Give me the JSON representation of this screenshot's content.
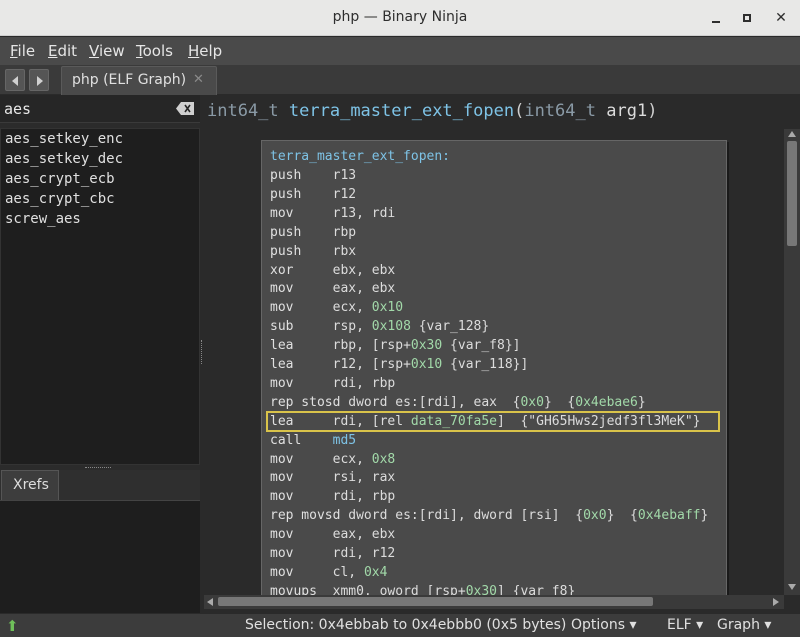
{
  "window": {
    "title": "php — Binary Ninja"
  },
  "menu": [
    "File",
    "Edit",
    "View",
    "Tools",
    "Help"
  ],
  "tab": {
    "label": "php (ELF Graph)"
  },
  "search": {
    "value": "aes"
  },
  "functions": [
    "aes_setkey_enc",
    "aes_setkey_dec",
    "aes_crypt_ecb",
    "aes_crypt_cbc",
    "screw_aes"
  ],
  "xrefs": {
    "tab_label": "Xrefs"
  },
  "signature": {
    "ret_type": "int64_t",
    "name": "terra_master_ext_fopen",
    "open": "(",
    "arg_type": "int64_t",
    "arg_name": "arg1",
    "close": ")"
  },
  "block": {
    "label": "terra_master_ext_fopen:",
    "instructions": [
      [
        "push",
        "r13"
      ],
      [
        "push",
        "r12"
      ],
      [
        "mov",
        "r13, rdi"
      ],
      [
        "push",
        "rbp"
      ],
      [
        "push",
        "rbx"
      ],
      [
        "xor",
        "ebx, ebx"
      ],
      [
        "mov",
        "eax, ebx"
      ],
      [
        "mov",
        "ecx, ",
        "0x10"
      ],
      [
        "sub",
        "rsp, ",
        "0x108",
        " {var_128}"
      ],
      [
        "lea",
        "rbp, [rsp+",
        "0x30",
        " {var_f8}]"
      ],
      [
        "lea",
        "r12, [rsp+",
        "0x10",
        " {var_118}]"
      ],
      [
        "mov",
        "rdi, rbp"
      ],
      [
        "rep stosd",
        "dword es:[rdi], eax  {",
        "0x0",
        "}  {",
        "0x4ebae6",
        "}"
      ],
      [
        "lea",
        "rdi, [rel ",
        "data_70fa5e",
        "]  {\"GH65Hws2jedf3fl3MeK\"}"
      ],
      [
        "call",
        "md5"
      ],
      [
        "mov",
        "ecx, ",
        "0x8"
      ],
      [
        "mov",
        "rsi, rax"
      ],
      [
        "mov",
        "rdi, rbp"
      ],
      [
        "rep movsd",
        "dword es:[rdi], dword [rsi]  {",
        "0x0",
        "}  {",
        "0x4ebaff",
        "}"
      ],
      [
        "mov",
        "eax, ebx"
      ],
      [
        "mov",
        "rdi, r12"
      ],
      [
        "mov",
        "cl, ",
        "0x4"
      ],
      [
        "movups",
        "xmm0, oword [rsp+",
        "0x30",
        "] {var_f8}"
      ]
    ]
  },
  "status": {
    "selection": "Selection: 0x4ebbab to 0x4ebbb0 (0x5 bytes)",
    "options": "Options ▾",
    "elf": "ELF ▾",
    "graph": "Graph ▾",
    "icon": "⬆"
  },
  "colors": {
    "highlight_border": "#d9c34a",
    "function_name": "#7ec3e6",
    "number": "#a2d9a9"
  }
}
